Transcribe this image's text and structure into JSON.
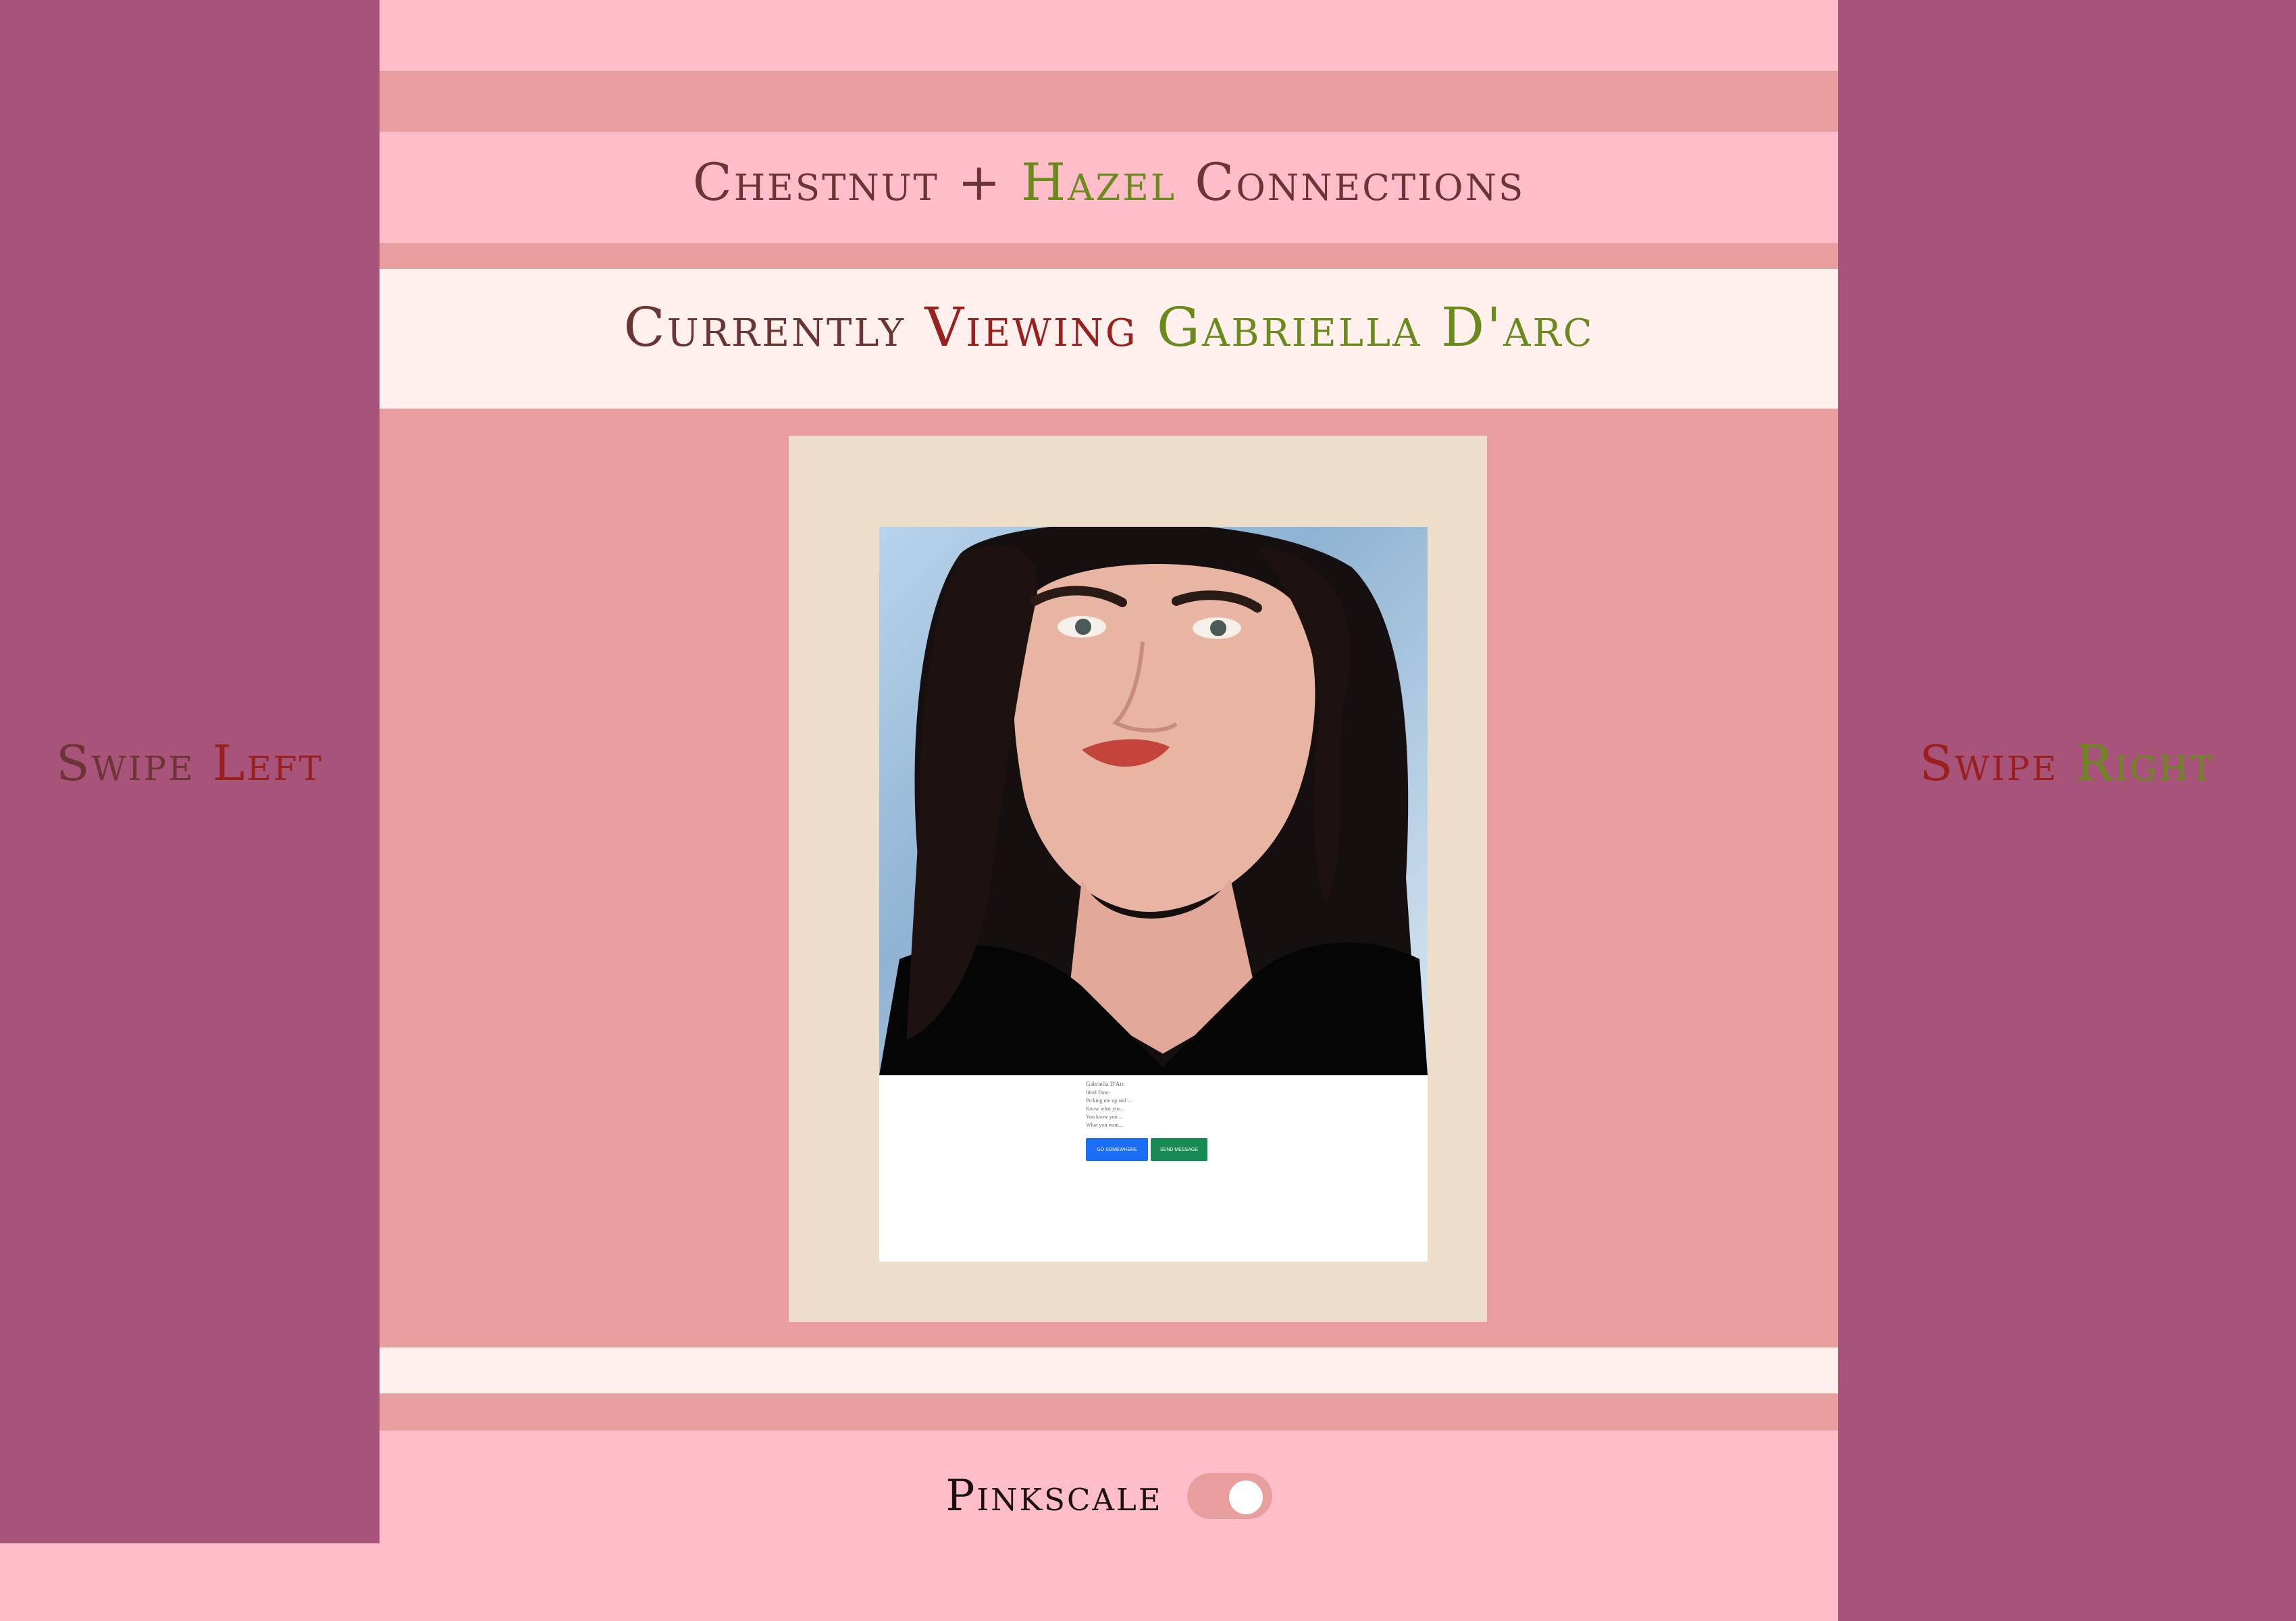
{
  "header": {
    "title_part1": "Chestnut +",
    "title_part2": "Hazel",
    "title_part3": "Connections"
  },
  "viewing": {
    "prefix": "Currently",
    "verb": "Viewing",
    "name": "Gabriella D'arc"
  },
  "swipe_left": {
    "word": "Swipe",
    "direction": "Left"
  },
  "swipe_right": {
    "word": "Swipe",
    "direction": "Right"
  },
  "profile": {
    "name_line": "Gabriella D'Arc",
    "lines": [
      "Ideal Date:",
      "Picking me up and ...",
      "Know what you...",
      "You know you ...",
      "What you want..."
    ],
    "button_primary": "Go somewhere",
    "button_secondary": "Send message"
  },
  "pinkscale": {
    "label": "Pinkscale",
    "enabled": true
  },
  "colors": {
    "side_panel": "#a8537a",
    "background": "#ffbcc9",
    "band": "#e99e9e",
    "light_band": "#fff0ee",
    "frame": "#ecdec8",
    "brown": "#6b3535",
    "red": "#9a1f1f",
    "green": "#6a8a1c",
    "button_blue": "#1a6ef5",
    "button_green": "#188a55"
  }
}
